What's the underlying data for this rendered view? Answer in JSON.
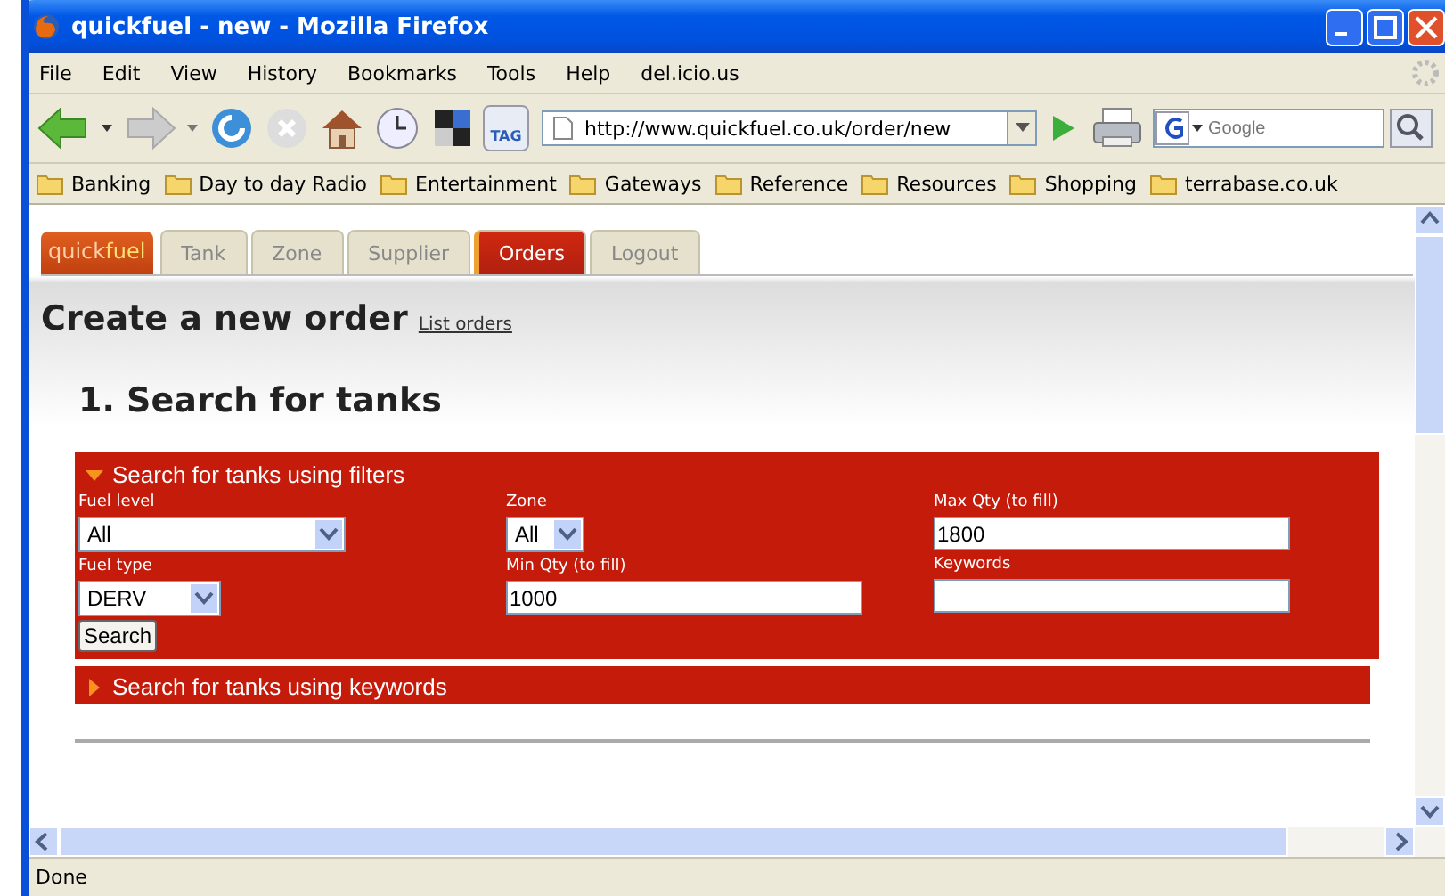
{
  "window": {
    "title": "quickfuel - new - Mozilla Firefox"
  },
  "menu": [
    "File",
    "Edit",
    "View",
    "History",
    "Bookmarks",
    "Tools",
    "Help",
    "del.icio.us"
  ],
  "toolbar": {
    "tag_label": "TAG",
    "address": "http://www.quickfuel.co.uk/order/new",
    "search_placeholder": "Google"
  },
  "bookmarks": [
    "Banking",
    "Day to day Radio",
    "Entertainment",
    "Gateways",
    "Reference",
    "Resources",
    "Shopping",
    "terrabase.co.uk"
  ],
  "logo": {
    "first": "quick",
    "second": "fuel"
  },
  "tabs": [
    {
      "label": "Tank",
      "selected": false
    },
    {
      "label": "Zone",
      "selected": false
    },
    {
      "label": "Supplier",
      "selected": false
    },
    {
      "label": "Orders",
      "selected": true
    },
    {
      "label": "Logout",
      "selected": false
    }
  ],
  "page": {
    "title": "Create a new order",
    "link": "List orders",
    "heading": "1. Search for tanks"
  },
  "sections": [
    {
      "title": "Search for tanks using filters",
      "expanded": true,
      "columns": [
        [
          {
            "label": "Fuel level",
            "kind": "select",
            "value": "All"
          },
          {
            "label": "Fuel type",
            "kind": "select",
            "value": "DERV"
          }
        ],
        [
          {
            "label": "Zone",
            "kind": "select",
            "value": "All"
          },
          {
            "label": "Min Qty (to fill)",
            "kind": "text",
            "value": "1000"
          }
        ],
        [
          {
            "label": "Max Qty (to fill)",
            "kind": "text",
            "value": "1800"
          },
          {
            "label": "Keywords",
            "kind": "text"
          }
        ]
      ],
      "button": "Search"
    },
    {
      "title": "Search for tanks using keywords",
      "expanded": false
    }
  ],
  "status_bar": "Done"
}
